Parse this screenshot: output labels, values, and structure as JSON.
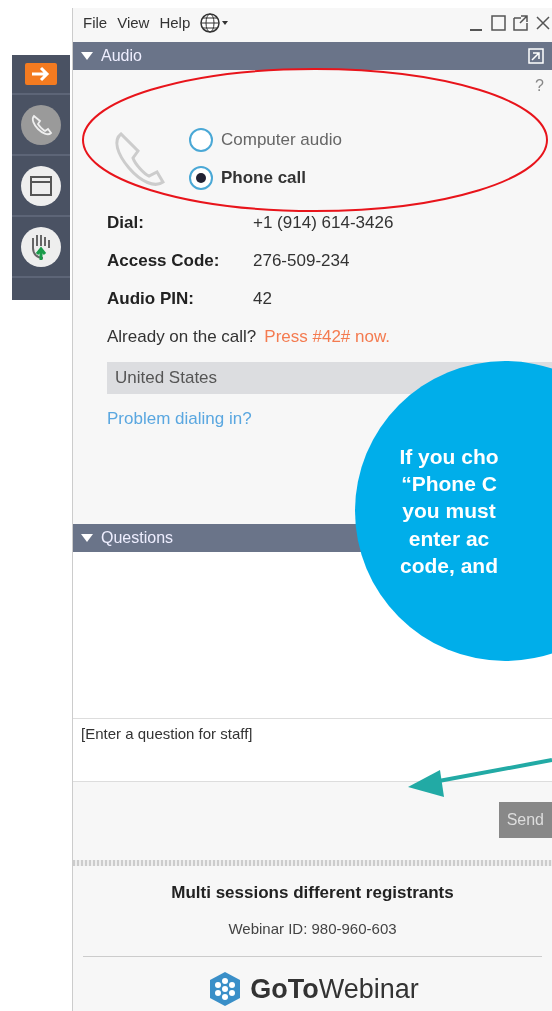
{
  "sidebar": {
    "items": [
      {
        "kind": "arrow",
        "selected": true
      },
      {
        "kind": "phone",
        "selected": false
      },
      {
        "kind": "window",
        "selected": false
      },
      {
        "kind": "hand",
        "selected": false
      }
    ]
  },
  "menu": [
    "File",
    "View",
    "Help"
  ],
  "audio": {
    "title": "Audio",
    "expanded": true,
    "help": "?",
    "options": [
      {
        "label": "Computer audio",
        "selected": false
      },
      {
        "label": "Phone call",
        "selected": true
      }
    ],
    "details": [
      {
        "label": "Dial:",
        "value": "+1 (914) 614-3426"
      },
      {
        "label": "Access Code:",
        "value": "276-509-234"
      },
      {
        "label": "Audio PIN:",
        "value": "42"
      }
    ],
    "already": "Already on the call?",
    "press": "Press #42# now.",
    "country": "United States",
    "problem_link": "Problem dialing in?"
  },
  "questions": {
    "title": "Questions",
    "expanded": true,
    "placeholder": "[Enter a question for staff]",
    "send": "Send",
    "send_disabled": true
  },
  "footer": {
    "title": "Multi sessions different registrants",
    "webinar_id": "Webinar ID: 980-960-603",
    "logo": "**GoTo**Webinar"
  },
  "callout": {
    "lines": [
      "If you cho",
      "“Phone C",
      "you must",
      "enter ac",
      "code, and"
    ]
  }
}
